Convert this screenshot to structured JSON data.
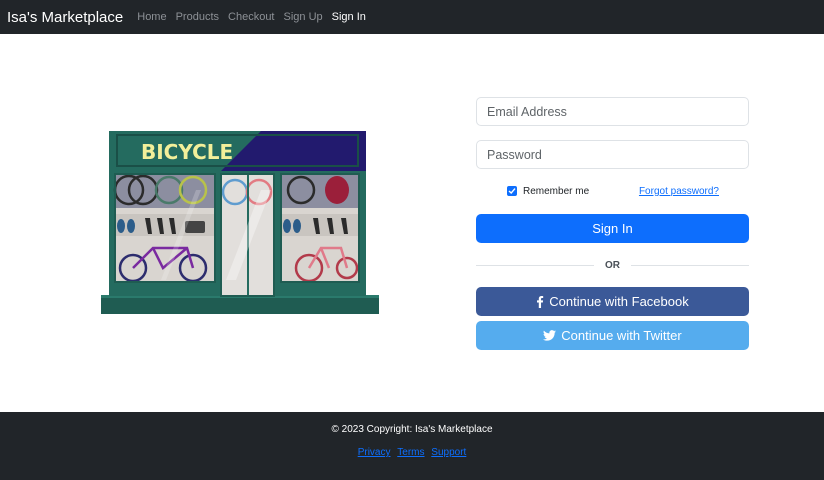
{
  "nav": {
    "brand": "Isa's Marketplace",
    "links": [
      "Home",
      "Products",
      "Checkout",
      "Sign Up",
      "Sign In"
    ]
  },
  "illustration": {
    "sign_text": "BICYCLE"
  },
  "form": {
    "email_placeholder": "Email Address",
    "password_placeholder": "Password",
    "remember_label": "Remember me",
    "remember_checked": true,
    "forgot_label": "Forgot password?",
    "signin_label": "Sign In",
    "or_label": "OR",
    "facebook_label": "Continue with Facebook",
    "twitter_label": "Continue with Twitter"
  },
  "footer": {
    "copyright": "© 2023 Copyright: Isa's Marketplace",
    "links": [
      "Privacy",
      "Terms",
      "Support"
    ]
  },
  "colors": {
    "navbar": "#212529",
    "primary": "#0d6efd",
    "facebook": "#3b5998",
    "twitter": "#55acee",
    "shop_green": "#246b5f",
    "shop_navy": "#221a6e"
  }
}
